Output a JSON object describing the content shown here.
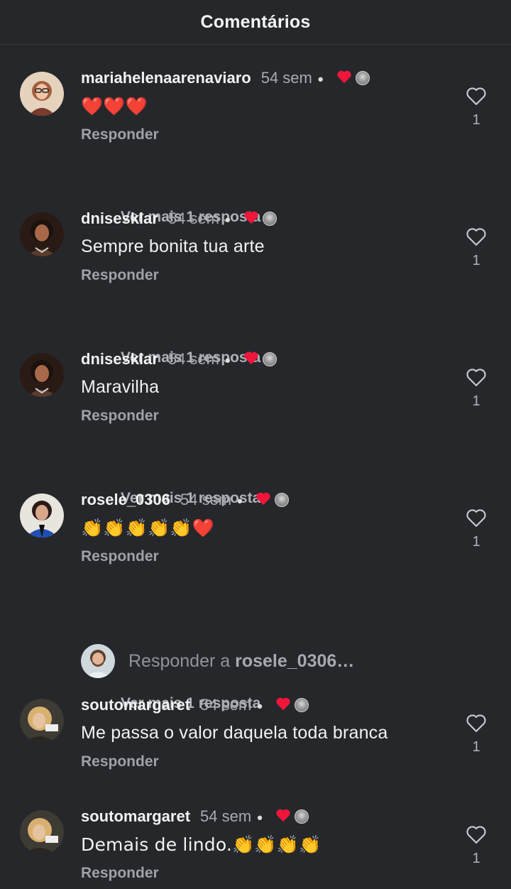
{
  "header": {
    "title": "Comentários"
  },
  "comments": [
    {
      "username": "mariahelenaarenaviaro",
      "time": "54 sem",
      "dot": "•",
      "text": "❤️❤️❤️",
      "reply_label": "Responder",
      "like_count": "1",
      "more_replies": "Ver mais 1 resposta",
      "avatar_color": "#c9a27f"
    },
    {
      "username": "dnisesklar",
      "time": "54 sem",
      "dot": "•",
      "text": "Sempre bonita tua arte",
      "reply_label": "Responder",
      "like_count": "1",
      "more_replies": "Ver mais 1 resposta",
      "avatar_color": "#5a3a2a"
    },
    {
      "username": "dnisesklar",
      "time": "54 sem",
      "dot": "•",
      "text": "Maravilha",
      "reply_label": "Responder",
      "like_count": "1",
      "more_replies": "Ver mais 1 resposta",
      "avatar_color": "#5a3a2a"
    },
    {
      "username": "rosele_0306",
      "time": "54 sem",
      "dot": "•",
      "text": "👏👏👏👏👏❤️",
      "reply_label": "Responder",
      "like_count": "1",
      "more_replies": "Ver mais 1 resposta",
      "avatar_color": "#2d4f9e"
    },
    {
      "username": "soutomargaret",
      "time": "54 sem",
      "dot": "•",
      "text": "Me passa o valor daquela toda branca",
      "reply_label": "Responder",
      "like_count": "1",
      "avatar_color": "#8c7a5c"
    },
    {
      "username": "soutomargaret",
      "time": "54 sem",
      "dot": "•",
      "text": "Demais de lindo.👏👏👏👏",
      "reply_label": "Responder",
      "like_count": "1",
      "avatar_color": "#8c7a5c"
    }
  ],
  "reply_composer": {
    "prefix": "Responder a ",
    "target": "rosele_0306…"
  },
  "colors": {
    "background": "#25272b",
    "heart_red": "#f0163b",
    "muted_text": "#a7abb1"
  },
  "icons": {
    "like": "heart-outline-icon",
    "creator_liked": "heart-filled-icon"
  }
}
